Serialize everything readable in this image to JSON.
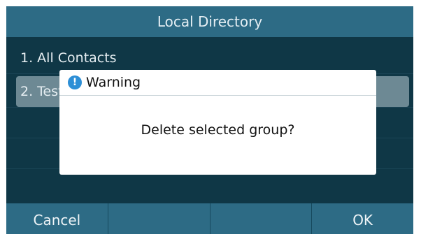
{
  "header": {
    "title": "Local Directory"
  },
  "list": {
    "items": [
      {
        "label": "1. All Contacts",
        "selected": false
      },
      {
        "label": "2. Test",
        "selected": true
      }
    ]
  },
  "dialog": {
    "icon": "info-icon",
    "title": "Warning",
    "message": "Delete selected group?"
  },
  "softkeys": {
    "left_label": "Cancel",
    "second_label": "",
    "third_label": "",
    "right_label": "OK"
  },
  "colors": {
    "background": "#0f3746",
    "bar": "#2d6b85",
    "selected_row": "#6d8994",
    "icon_blue": "#2d8fd6"
  }
}
